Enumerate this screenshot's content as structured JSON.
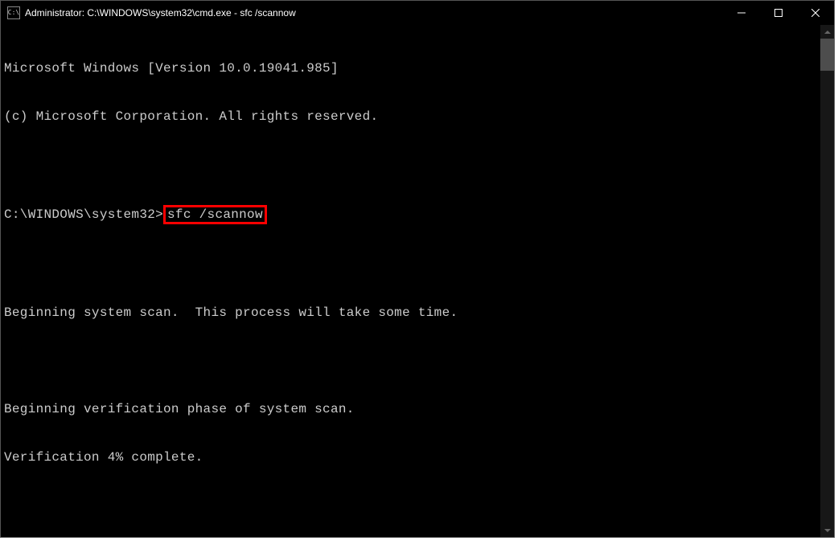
{
  "titlebar": {
    "icon_label": "C:\\",
    "title": "Administrator: C:\\WINDOWS\\system32\\cmd.exe - sfc  /scannow"
  },
  "terminal": {
    "line1": "Microsoft Windows [Version 10.0.19041.985]",
    "line2": "(c) Microsoft Corporation. All rights reserved.",
    "blank1": "",
    "prompt": "C:\\WINDOWS\\system32>",
    "command": "sfc /scannow",
    "blank2": "",
    "line3": "Beginning system scan.  This process will take some time.",
    "blank3": "",
    "line4": "Beginning verification phase of system scan.",
    "line5": "Verification 4% complete."
  }
}
